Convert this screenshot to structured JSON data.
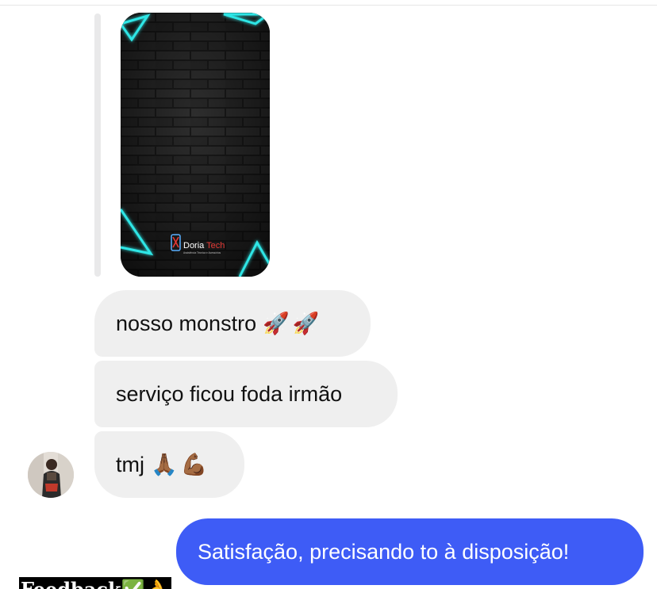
{
  "conversation": {
    "shared_media": {
      "brand_name_part1": "Doria",
      "brand_name_part2": "Tech",
      "brand_tagline": "Assistência Técnica e Acessórios"
    },
    "messages": [
      {
        "direction": "incoming",
        "text": "nosso monstro",
        "emoji_1": "🚀",
        "emoji_2": "🚀"
      },
      {
        "direction": "incoming",
        "text": "serviço ficou foda irmão"
      },
      {
        "direction": "incoming",
        "text": "tmj",
        "emoji_1": "🙏🏾",
        "emoji_2": "💪🏾"
      },
      {
        "direction": "outgoing",
        "text": "Satisfação, precisando to à disposição!"
      }
    ]
  },
  "caption": {
    "text": "Feedback✅👌"
  },
  "colors": {
    "incoming_bubble": "#efefef",
    "outgoing_bubble": "#3e5cf6",
    "neon_accent": "#2ee6e6",
    "brand_accent": "#e53935"
  }
}
